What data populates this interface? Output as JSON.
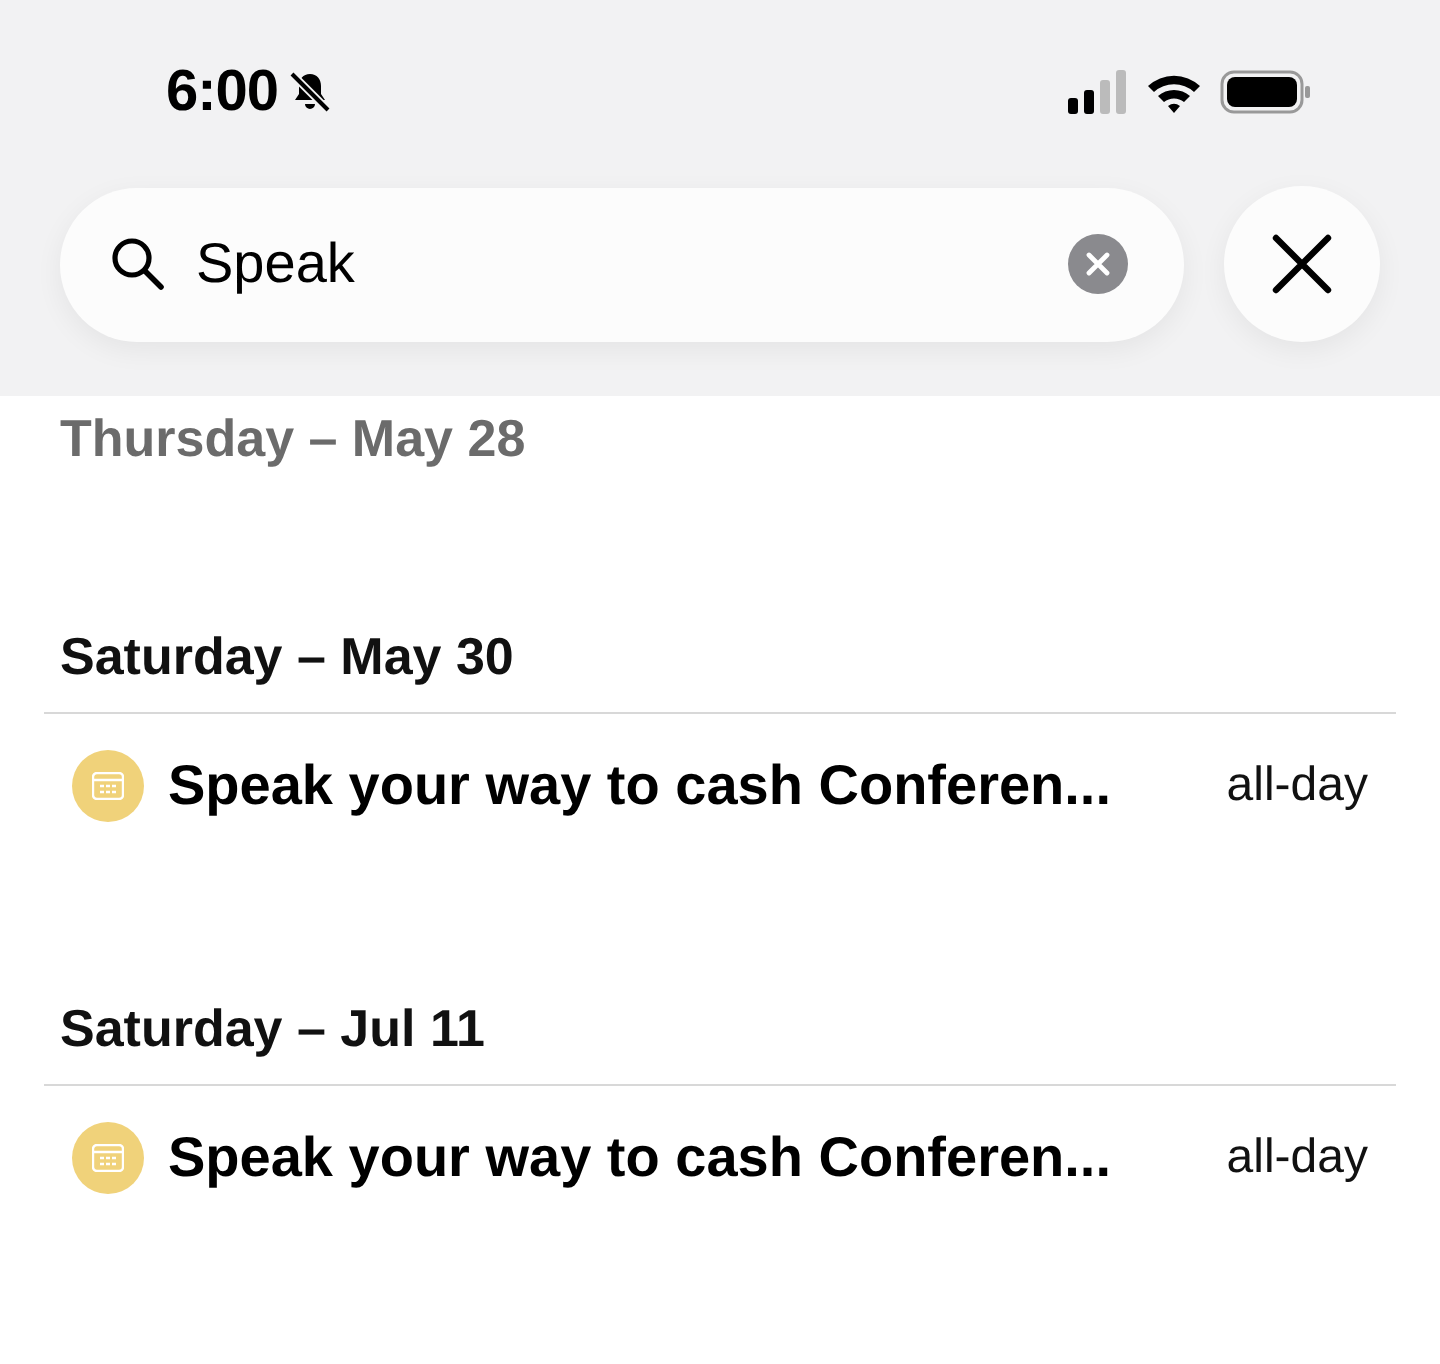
{
  "status_bar": {
    "time": "6:00",
    "silenced": true
  },
  "search": {
    "value": "Speak"
  },
  "sections": [
    {
      "heading": "Thursday – May 28",
      "faded": true
    },
    {
      "heading": "Saturday – May 30",
      "faded": false,
      "events": [
        {
          "title": "Speak your way to cash Conferen...",
          "time": "all-day",
          "color": "#f0d27a"
        }
      ]
    },
    {
      "heading": "Saturday – Jul 11",
      "faded": false,
      "events": [
        {
          "title": "Speak your way to cash Conferen...",
          "time": "all-day",
          "color": "#f0d27a"
        }
      ]
    }
  ]
}
